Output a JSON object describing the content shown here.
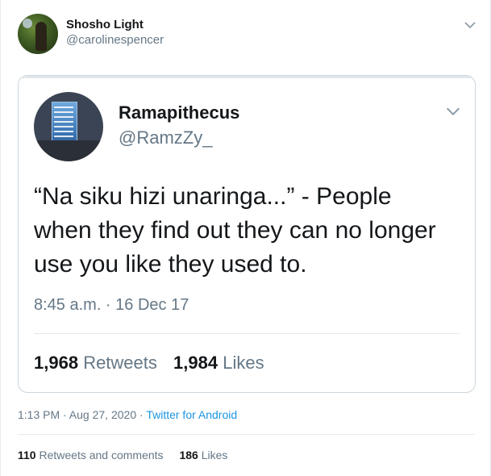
{
  "tweet": {
    "author": {
      "name": "Shosho Light",
      "handle": "@carolinespencer"
    },
    "menu_icon": "chevron-down-icon",
    "timestamp": "1:13 PM · Aug 27, 2020",
    "separator": " · ",
    "source": "Twitter for Android",
    "stats": {
      "retweets_count": "110",
      "retweets_label": "Retweets and comments",
      "likes_count": "186",
      "likes_label": "Likes"
    }
  },
  "quoted_tweet": {
    "author": {
      "name": "Ramapithecus",
      "handle": "@RamzZy_"
    },
    "text": "“Na siku hizi unaringa...” - People when they find out they can no longer use you like they used to.",
    "timestamp": "8:45 a.m. · 16 Dec 17",
    "stats": {
      "retweets_count": "1,968",
      "retweets_label": "Retweets",
      "likes_count": "1,984",
      "likes_label": "Likes"
    }
  },
  "colors": {
    "text_primary": "#14171a",
    "text_secondary": "#657786",
    "link": "#1b95e0",
    "border": "#ccd6dd"
  }
}
